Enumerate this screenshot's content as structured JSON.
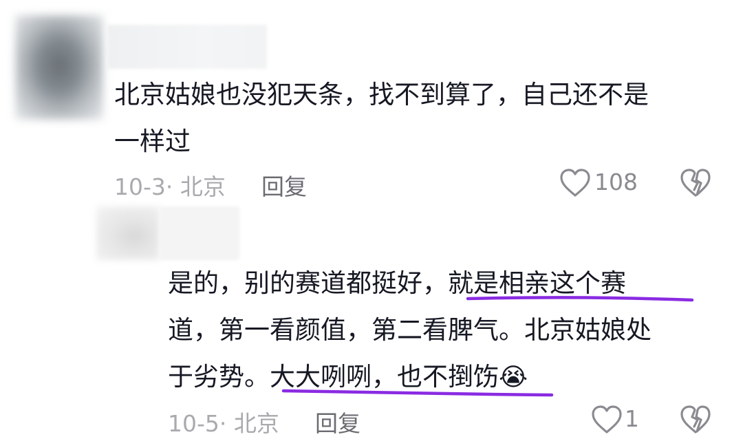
{
  "comments": [
    {
      "text_line1": "北京姑娘也没犯天条，找不到算了，自己还不是",
      "text_line2": "一样过",
      "date_location": "10-3· 北京",
      "reply_label": "回复",
      "like_count": "108"
    },
    {
      "text_line1_plain": "是的，别的赛道都挺好，",
      "text_line1_highlight": "就是相亲这个赛",
      "text_line2": "道，第一看颜值，第二看脾气。北京姑娘处",
      "text_line3_plain": "于劣势。",
      "text_line3_highlight": "大大咧咧，也不捯饬",
      "emoji": "😭",
      "date_location": "10-5· 北京",
      "reply_label": "回复",
      "like_count": "1"
    }
  ],
  "colors": {
    "text": "#161823",
    "meta": "#a9aaae",
    "reply": "#6b6c72",
    "highlight_underline": "#8a2be2"
  },
  "icons": {
    "like": "heart-outline-icon",
    "dislike": "broken-heart-icon"
  }
}
